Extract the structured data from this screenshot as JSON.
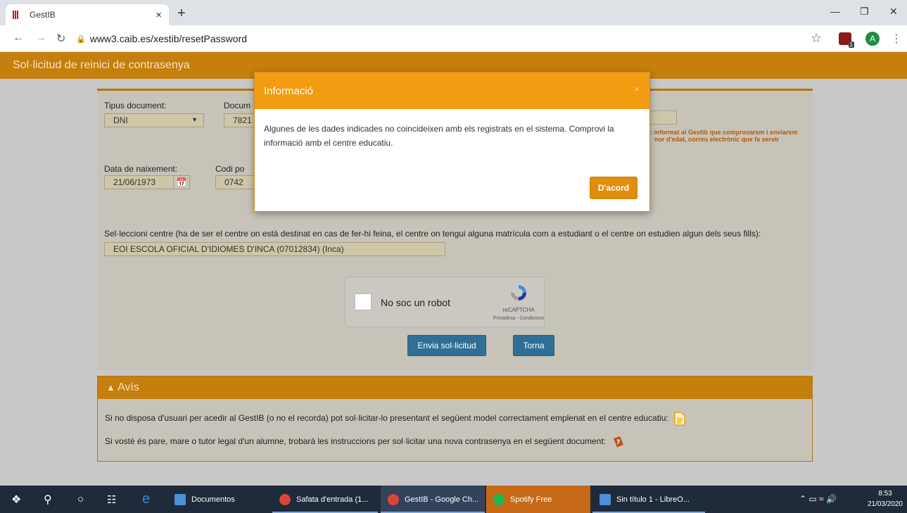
{
  "browser": {
    "tab_title": "GestIB",
    "tab_close": "×",
    "new_tab": "+",
    "url": "www3.caib.es/xestib/resetPassword",
    "ext_badge": "1",
    "avatar_letter": "A"
  },
  "page": {
    "header_title": "Sol·licitud de reinici de contrasenya",
    "form": {
      "doc_type_label": "Tipus document:",
      "doc_type_value": "DNI",
      "doc_label": "Docum",
      "doc_value": "7821",
      "birth_label": "Data de naixement:",
      "birth_value": "21/06/1973",
      "postal_label": "Codi po",
      "postal_value": "0742",
      "warn_line1": ": informat al Gestib que comprovarem i enviarem",
      "warn_line2": "nor d'edat, correu electrònic que fa servir",
      "center_label": "Sel·leccioni centre (ha de ser el centre on està destinat en cas de fer-hi feina, el centre on tengui alguna matrícula com a estudiant o el centre on estudien algun dels seus fills):",
      "center_value": "EOI ESCOLA OFICIAL D'IDIOMES D'INCA (07012834) (Inca)",
      "recaptcha_label": "No soc un robot",
      "recaptcha_brand": "reCAPTCHA",
      "recaptcha_links": "Privadesa - Condicions",
      "submit_label": "Envia sol·licitud",
      "back_label": "Torna"
    },
    "avis": {
      "title": "Avís",
      "line1": "Si no disposa d'usuari per acedir al GestIB (o no el recorda) pot sol·licitar-lo presentant el següent model correctament emplenat en el centre educatiu:",
      "line2": "Si vostè és pare, mare o tutor legal d'un alumne, trobarà les instruccions per sol·licitar una nova contrasenya en el següent document:"
    }
  },
  "modal": {
    "title": "Informació",
    "close": "×",
    "body": "Algunes de les dades indicades no coincideixen amb els registrats en el sistema. Comprovi la informació amb el centre educatiu.",
    "ok_label": "D'acord"
  },
  "taskbar": {
    "apps": [
      {
        "label": "Documentos"
      },
      {
        "label": "Safata d'entrada (1..."
      },
      {
        "label": "GestIB - Google Ch..."
      },
      {
        "label": "Spotify Free"
      },
      {
        "label": "Sin título 1 - LibreO..."
      }
    ],
    "time": "8:53",
    "date": "21/03/2020"
  },
  "colors": {
    "header": "#c57f0c",
    "modal_header": "#f39c12",
    "primary_button": "#2f6f95"
  }
}
